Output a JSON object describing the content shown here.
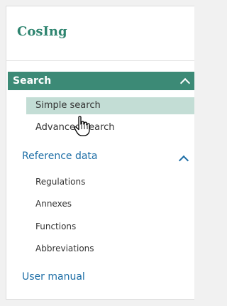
{
  "brand": {
    "title": "CosIng"
  },
  "search_section": {
    "label": "Search",
    "items": [
      {
        "label": "Simple search"
      },
      {
        "label": "Advanced search"
      }
    ]
  },
  "reference_section": {
    "label": "Reference data",
    "items": [
      {
        "label": "Regulations"
      },
      {
        "label": "Annexes"
      },
      {
        "label": "Functions"
      },
      {
        "label": "Abbreviations"
      }
    ]
  },
  "user_manual": {
    "label": "User manual"
  },
  "colors": {
    "brand": "#2f8570",
    "section_header": "#3c8a76",
    "selected_item": "#c3ddd5",
    "link": "#1d6ea6"
  },
  "icons": [
    "chevron-up-icon",
    "hand-pointer-cursor-icon"
  ]
}
